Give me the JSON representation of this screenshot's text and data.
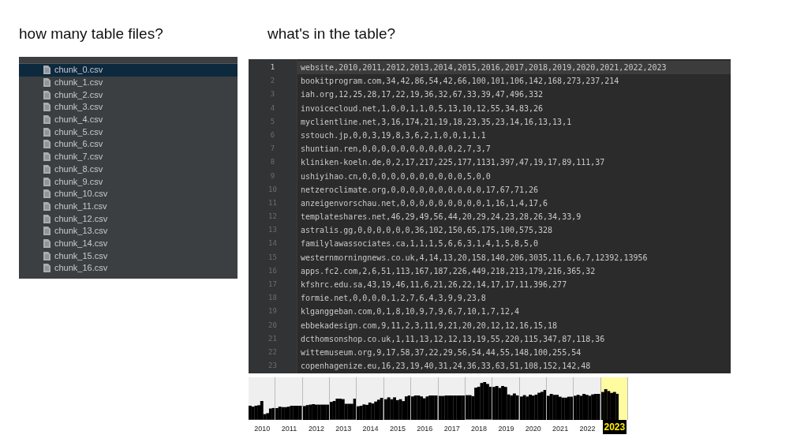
{
  "headings": [
    "how many table files?",
    "what's in the table?"
  ],
  "files": [
    {
      "name": "chunk_0.csv",
      "selected": true
    },
    {
      "name": "chunk_1.csv",
      "selected": false
    },
    {
      "name": "chunk_2.csv",
      "selected": false
    },
    {
      "name": "chunk_3.csv",
      "selected": false
    },
    {
      "name": "chunk_4.csv",
      "selected": false
    },
    {
      "name": "chunk_5.csv",
      "selected": false
    },
    {
      "name": "chunk_6.csv",
      "selected": false
    },
    {
      "name": "chunk_7.csv",
      "selected": false
    },
    {
      "name": "chunk_8.csv",
      "selected": false
    },
    {
      "name": "chunk_9.csv",
      "selected": false
    },
    {
      "name": "chunk_10.csv",
      "selected": false
    },
    {
      "name": "chunk_11.csv",
      "selected": false
    },
    {
      "name": "chunk_12.csv",
      "selected": false
    },
    {
      "name": "chunk_13.csv",
      "selected": false
    },
    {
      "name": "chunk_14.csv",
      "selected": false
    },
    {
      "name": "chunk_15.csv",
      "selected": false
    },
    {
      "name": "chunk_16.csv",
      "selected": false
    }
  ],
  "editor": {
    "lines": [
      {
        "number": "1",
        "text": "website,2010,2011,2012,2013,2014,2015,2016,2017,2018,2019,2020,2021,2022,2023",
        "current": true
      },
      {
        "number": "2",
        "text": "bookitprogram.com,34,42,86,54,42,66,100,101,106,142,168,273,237,214",
        "current": false
      },
      {
        "number": "3",
        "text": "iah.org,12,25,28,17,22,19,36,32,67,33,39,47,496,332",
        "current": false
      },
      {
        "number": "4",
        "text": "invoicecloud.net,1,0,0,1,1,0,5,13,10,12,55,34,83,26",
        "current": false
      },
      {
        "number": "5",
        "text": "myclientline.net,3,16,174,21,19,18,23,35,23,14,16,13,13,1",
        "current": false
      },
      {
        "number": "6",
        "text": "sstouch.jp,0,0,3,19,8,3,6,2,1,0,0,1,1,1",
        "current": false
      },
      {
        "number": "7",
        "text": "shuntian.ren,0,0,0,0,0,0,0,0,0,0,2,7,3,7",
        "current": false
      },
      {
        "number": "8",
        "text": "kliniken-koeln.de,0,2,17,217,225,177,1131,397,47,19,17,89,111,37",
        "current": false
      },
      {
        "number": "9",
        "text": "ushiyihao.cn,0,0,0,0,0,0,0,0,0,0,0,5,0,0",
        "current": false
      },
      {
        "number": "10",
        "text": "netzeroclimate.org,0,0,0,0,0,0,0,0,0,0,17,67,71,26",
        "current": false
      },
      {
        "number": "11",
        "text": "anzeigenvorschau.net,0,0,0,0,0,0,0,0,0,1,16,1,4,17,6",
        "current": false
      },
      {
        "number": "12",
        "text": "templateshares.net,46,29,49,56,44,20,29,24,23,28,26,34,33,9",
        "current": false
      },
      {
        "number": "13",
        "text": "astralis.gg,0,0,0,0,0,0,36,102,150,65,175,100,575,328",
        "current": false
      },
      {
        "number": "14",
        "text": "familylawassociates.ca,1,1,1,5,6,6,3,1,4,1,5,8,5,0",
        "current": false
      },
      {
        "number": "15",
        "text": "westernmorningnews.co.uk,4,14,13,20,158,140,206,3035,11,6,6,7,12392,13956",
        "current": false
      },
      {
        "number": "16",
        "text": "apps.fc2.com,2,6,51,113,167,187,226,449,218,213,179,216,365,32",
        "current": false
      },
      {
        "number": "17",
        "text": "kfshrc.edu.sa,43,19,46,11,6,21,26,22,14,17,17,11,396,277",
        "current": false
      },
      {
        "number": "18",
        "text": "formie.net,0,0,0,0,1,2,7,6,4,3,9,9,23,8",
        "current": false
      },
      {
        "number": "19",
        "text": "klganggeban.com,0,1,8,10,9,7,9,6,7,10,1,7,12,4",
        "current": false
      },
      {
        "number": "20",
        "text": "ebbekadesign.com,9,11,2,3,11,9,21,20,20,12,12,16,15,18",
        "current": false
      },
      {
        "number": "21",
        "text": "dcthomsonshop.co.uk,1,11,13,12,12,13,19,55,220,115,347,87,118,36",
        "current": false
      },
      {
        "number": "22",
        "text": "wittemuseum.org,9,17,58,37,22,29,56,54,44,55,148,100,255,54",
        "current": false
      },
      {
        "number": "23",
        "text": "copenhagenize.eu,16,23,19,40,31,24,36,33,63,51,108,152,142,48",
        "current": false
      }
    ]
  },
  "timeline": {
    "years": [
      {
        "label": "2010",
        "selected": false
      },
      {
        "label": "2011",
        "selected": false
      },
      {
        "label": "2012",
        "selected": false
      },
      {
        "label": "2013",
        "selected": false
      },
      {
        "label": "2014",
        "selected": false
      },
      {
        "label": "2015",
        "selected": false
      },
      {
        "label": "2016",
        "selected": false
      },
      {
        "label": "2017",
        "selected": false
      },
      {
        "label": "2018",
        "selected": false
      },
      {
        "label": "2019",
        "selected": false
      },
      {
        "label": "2020",
        "selected": false
      },
      {
        "label": "2021",
        "selected": false
      },
      {
        "label": "2022",
        "selected": false
      },
      {
        "label": "2023",
        "selected": true
      }
    ]
  }
}
